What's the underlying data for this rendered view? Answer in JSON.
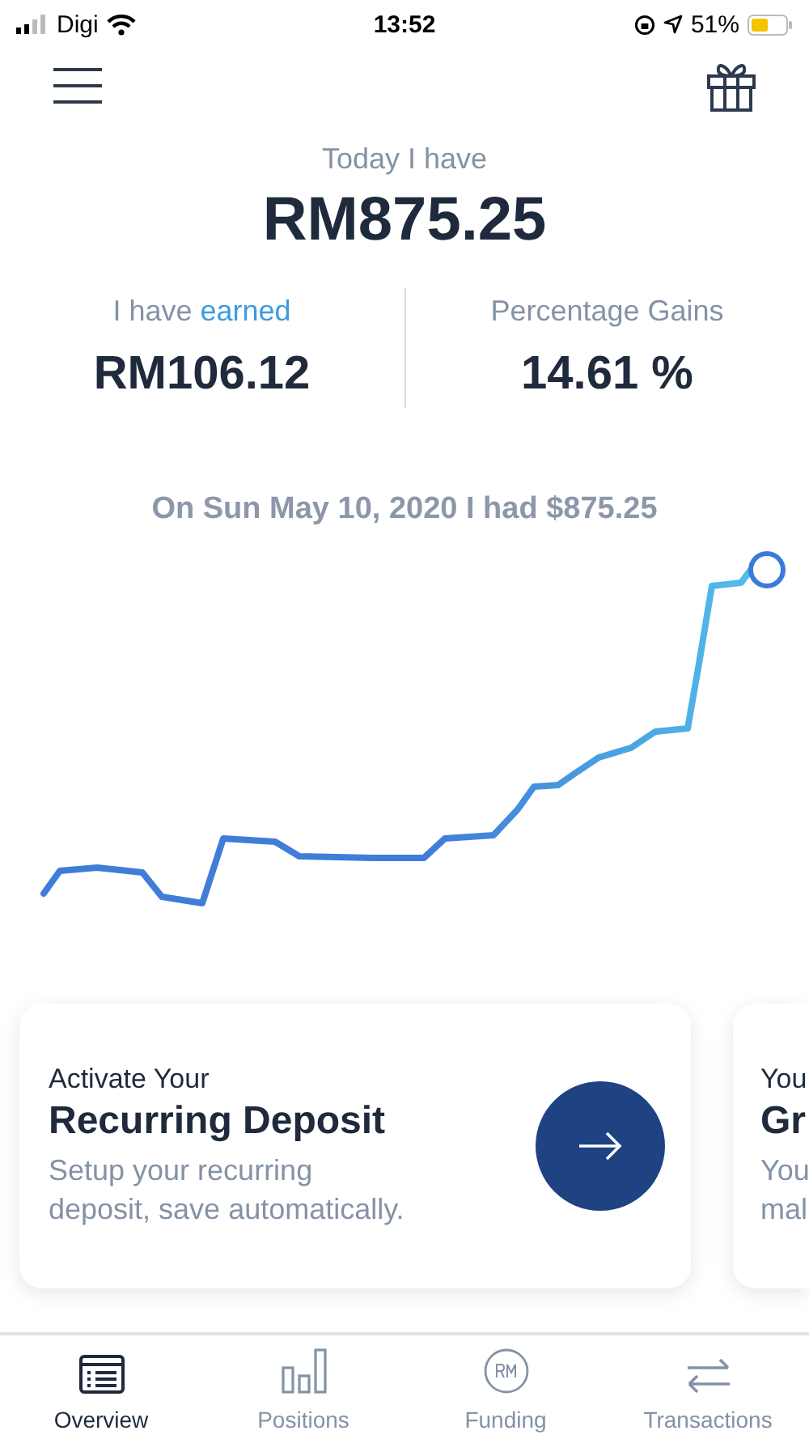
{
  "status_bar": {
    "carrier": "Digi",
    "time": "13:52",
    "battery": "51%"
  },
  "summary": {
    "label": "Today I have",
    "amount": "RM875.25"
  },
  "stats": [
    {
      "label": "I have",
      "label_link": "earned",
      "value": "RM106.12"
    },
    {
      "label": "Percentage Gains",
      "value": "14.61 %"
    }
  ],
  "chart": {
    "title": "On Sun May 10, 2020 I had $875.25"
  },
  "cards": [
    {
      "eyebrow": "Activate Your",
      "title": "Recurring Deposit",
      "description_lines": [
        "Setup your recurring",
        "deposit, save automatically."
      ],
      "kind": "action"
    },
    {
      "eyebrow": "You",
      "title": "Gr",
      "description_lines": [
        "You",
        "mal"
      ],
      "kind": "preview"
    }
  ],
  "tabs": [
    {
      "label": "Overview",
      "selected": true
    },
    {
      "label": "Positions",
      "selected": false
    },
    {
      "label": "Funding",
      "selected": false
    },
    {
      "label": "Transactions",
      "selected": false
    }
  ]
}
